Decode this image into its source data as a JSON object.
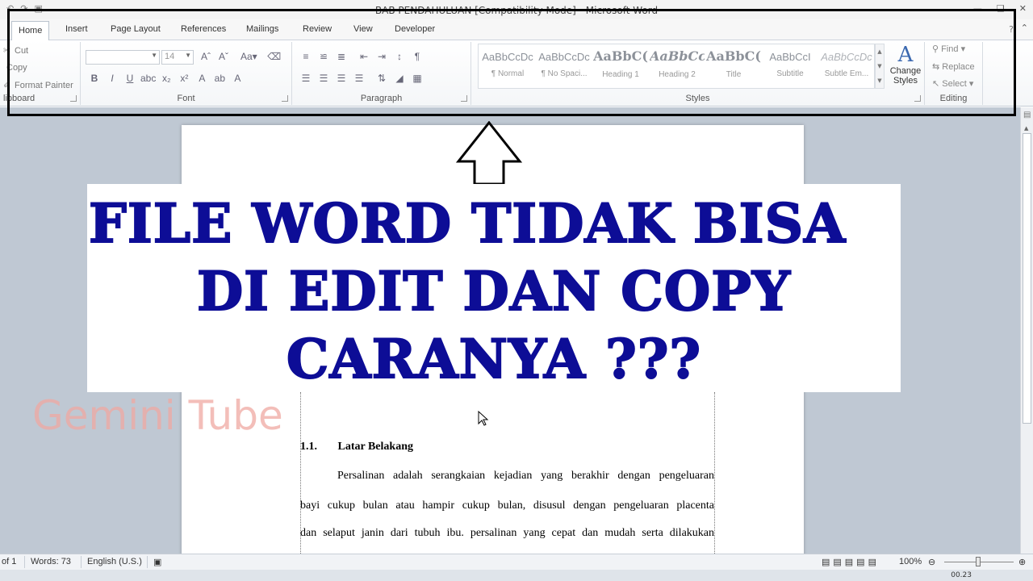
{
  "window": {
    "title": "BAB PENDAHULUAN [Compatibility Mode] - Microsoft Word"
  },
  "tabs": [
    "Home",
    "Insert",
    "Page Layout",
    "References",
    "Mailings",
    "Review",
    "View",
    "Developer"
  ],
  "clipboard": {
    "cut": "Cut",
    "copy": "Copy",
    "format_painter": "Format Painter",
    "label": "lipboard"
  },
  "font": {
    "size": "14",
    "label": "Font"
  },
  "paragraph": {
    "label": "Paragraph"
  },
  "styles": {
    "label": "Styles",
    "items": [
      {
        "sample": "AaBbCcDc",
        "name": "¶ Normal"
      },
      {
        "sample": "AaBbCcDc",
        "name": "¶ No Spaci..."
      },
      {
        "sample": "AaBbC(",
        "name": "Heading 1"
      },
      {
        "sample": "AaBbCc",
        "name": "Heading 2"
      },
      {
        "sample": "AaBbC(",
        "name": "Title"
      },
      {
        "sample": "AaBbCcI",
        "name": "Subtitle"
      },
      {
        "sample": "AaBbCcDc",
        "name": "Subtle Em..."
      }
    ],
    "change_styles": "Change Styles"
  },
  "editing": {
    "find": "Find",
    "replace": "Replace",
    "select": "Select",
    "label": "Editing"
  },
  "document": {
    "heading_number": "1.1.",
    "heading_text": "Latar Belakang",
    "lines": [
      "Persalinan adalah serangkaian kejadian yang berakhir dengan pengeluaran",
      "bayi cukup bulan atau hampir cukup bulan, disusul dengan pengeluaran placenta",
      "dan selaput janin dari tubuh ibu. persalinan yang cepat dan mudah serta dilakukan"
    ]
  },
  "overlay": {
    "line1": "FILE WORD TIDAK BISA",
    "line2": "DI EDIT DAN COPY",
    "line3": "CARANYA ???",
    "text_color": "#0d0d96",
    "watermark": "Gemini Tube"
  },
  "status": {
    "page": "of 1",
    "words": "Words: 73",
    "language": "English (U.S.)",
    "zoom": "100%"
  },
  "taskbar": {
    "clock": "00.23"
  }
}
